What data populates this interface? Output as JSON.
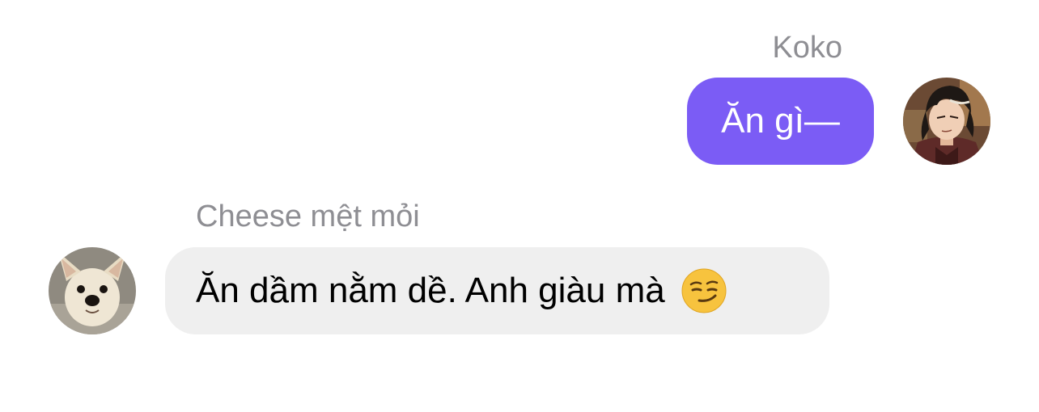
{
  "messages": [
    {
      "sender": "Koko",
      "direction": "outgoing",
      "text": "Ăn gì—",
      "avatar_icon": "anime-character-avatar"
    },
    {
      "sender": "Cheese mệt mỏi",
      "direction": "incoming",
      "text": "Ăn dầm nằm dề. Anh giàu mà",
      "emoji": "smirking-face-emoji",
      "avatar_icon": "chihuahua-dog-avatar"
    }
  ],
  "colors": {
    "outgoing_bubble": "#7b5cf5",
    "incoming_bubble": "#efefef",
    "sender_name": "#8e8e93"
  }
}
